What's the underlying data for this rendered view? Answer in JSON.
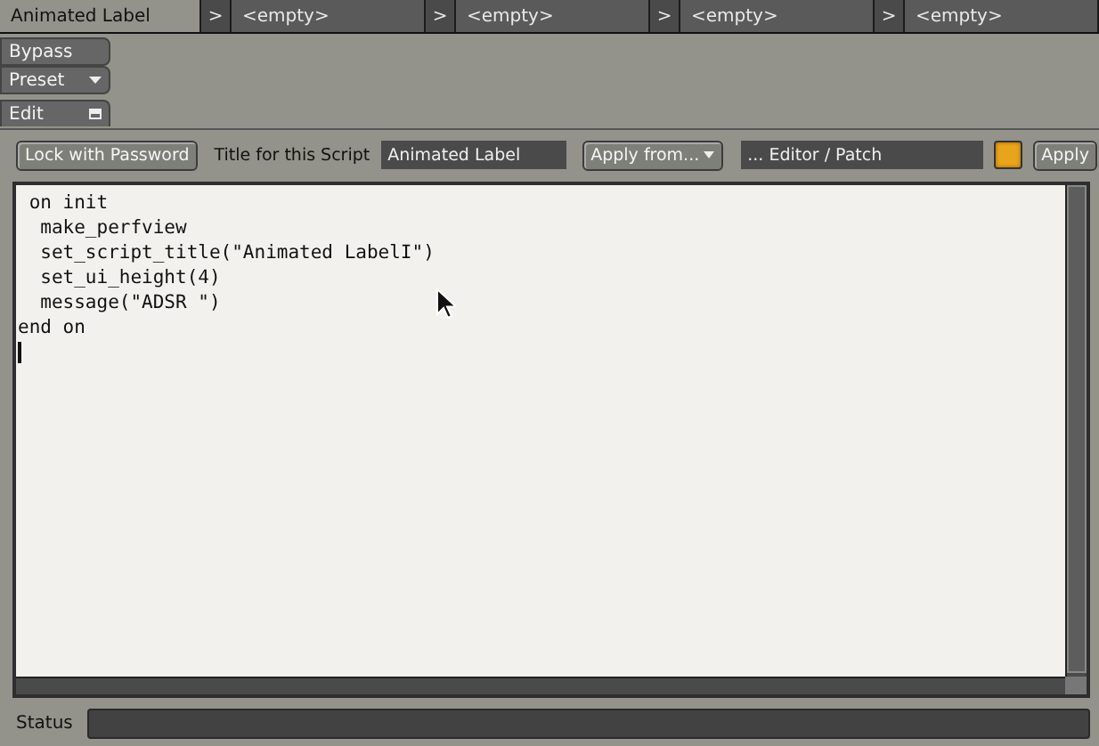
{
  "slot_tabs": [
    {
      "label": "Animated Label",
      "selected": true
    },
    {
      "arrow": ">",
      "label": "<empty>",
      "selected": false
    },
    {
      "arrow": ">",
      "label": "<empty>",
      "selected": false
    },
    {
      "arrow": ">",
      "label": "<empty>",
      "selected": false
    },
    {
      "arrow": ">",
      "label": "<empty>",
      "selected": false
    }
  ],
  "side_buttons": [
    {
      "kind": "plain",
      "label": "Bypass"
    },
    {
      "kind": "dropdown",
      "label": "Preset"
    },
    {
      "kind": "edit",
      "label": "Edit"
    }
  ],
  "toolbar": {
    "lock_button": "Lock with Password",
    "title_label": "Title for this Script",
    "title_value": "Animated Label",
    "apply_from": "Apply from...",
    "source_value": "... Editor / Patch",
    "indicator_on": true,
    "apply_button": "Apply"
  },
  "editor": {
    "lines": [
      " on init",
      "  make_perfview",
      "  set_script_title(\"Animated LabelI\")",
      "  set_ui_height(4)",
      "  message(\"ADSR \")",
      "end on"
    ]
  },
  "status": {
    "label": "Status"
  }
}
